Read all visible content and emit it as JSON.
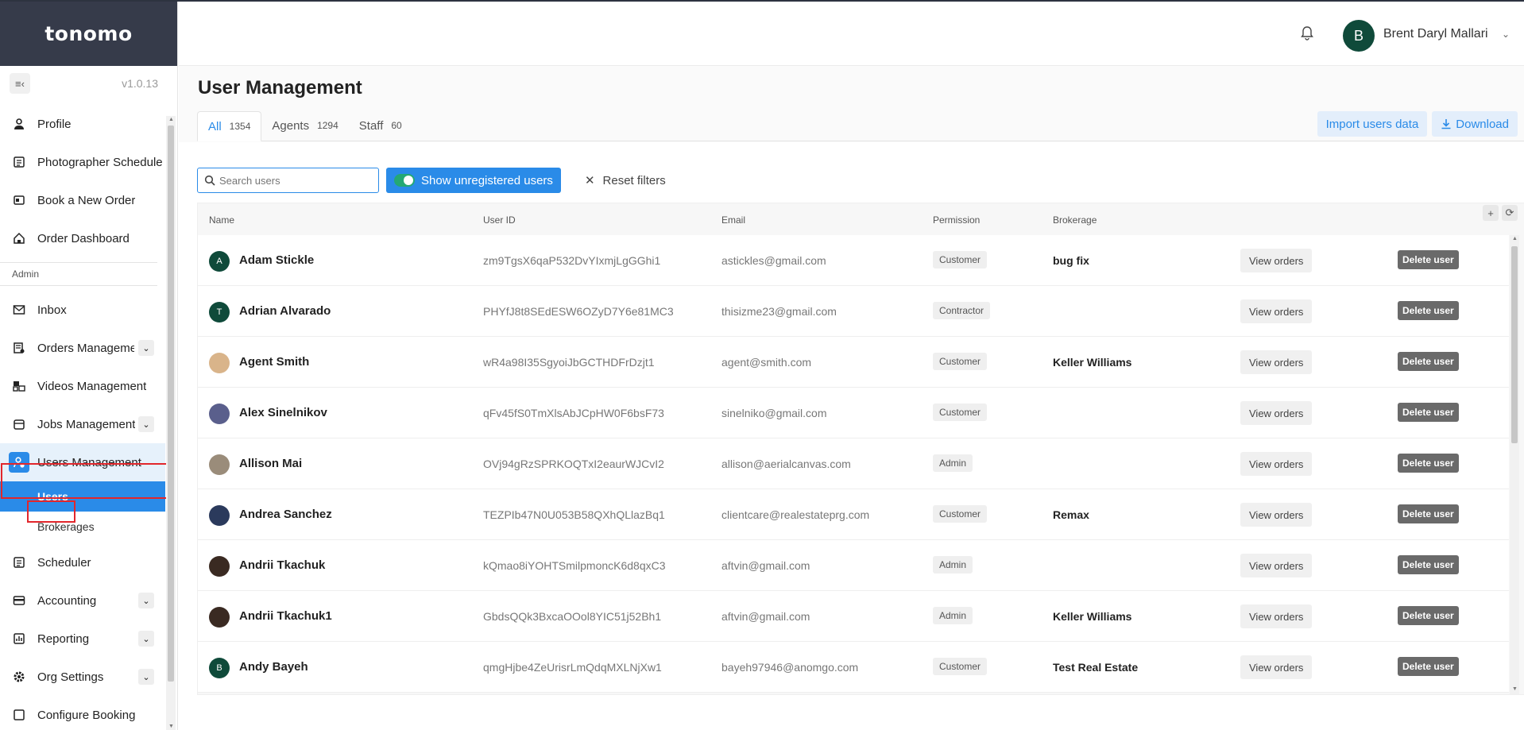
{
  "app": {
    "logo": "tonomo",
    "version": "v1.0.13"
  },
  "header": {
    "user_initial": "B",
    "user_name": "Brent Daryl Mallari"
  },
  "sidebar": {
    "items": [
      {
        "label": "Profile",
        "icon": "user-icon"
      },
      {
        "label": "Photographer Schedule",
        "icon": "schedule-icon"
      },
      {
        "label": "Book a New Order",
        "icon": "book-icon"
      },
      {
        "label": "Order Dashboard",
        "icon": "home-icon"
      }
    ],
    "section_label": "Admin",
    "admin_items": [
      {
        "label": "Inbox",
        "icon": "mail-icon"
      },
      {
        "label": "Orders Management",
        "icon": "orders-icon"
      },
      {
        "label": "Videos Management",
        "icon": "video-icon"
      },
      {
        "label": "Jobs Management",
        "icon": "jobs-icon"
      },
      {
        "label": "Users Management",
        "icon": "users-icon"
      }
    ],
    "sub_items": [
      {
        "label": "Users"
      },
      {
        "label": "Brokerages"
      }
    ],
    "bottom_items": [
      {
        "label": "Scheduler"
      },
      {
        "label": "Accounting"
      },
      {
        "label": "Reporting"
      },
      {
        "label": "Org Settings"
      },
      {
        "label": "Configure Booking"
      }
    ]
  },
  "page": {
    "title": "User Management",
    "tabs": [
      {
        "label": "All",
        "count": "1354"
      },
      {
        "label": "Agents",
        "count": "1294"
      },
      {
        "label": "Staff",
        "count": "60"
      }
    ],
    "import_label": "Import users data",
    "download_label": "Download"
  },
  "filters": {
    "search_placeholder": "Search users",
    "toggle_label": "Show unregistered users",
    "reset_label": "Reset filters"
  },
  "table": {
    "columns": {
      "name": "Name",
      "user_id": "User ID",
      "email": "Email",
      "permission": "Permission",
      "brokerage": "Brokerage"
    },
    "view_label": "View orders",
    "delete_label": "Delete user",
    "rows": [
      {
        "initial": "A",
        "avatar_color": "#0f4a3a",
        "name": "Adam Stickle",
        "user_id": "zm9TgsX6qaP532DvYIxmjLgGGhi1",
        "email": "astickles@gmail.com",
        "permission": "Customer",
        "brokerage": "bug fix"
      },
      {
        "initial": "T",
        "avatar_color": "#0f4a3a",
        "name": "Adrian Alvarado",
        "user_id": "PHYfJ8t8SEdESW6OZyD7Y6e81MC3",
        "email": "thisizme23@gmail.com",
        "permission": "Contractor",
        "brokerage": ""
      },
      {
        "initial": "",
        "avatar_color": "#d9b48a",
        "name": "Agent Smith",
        "user_id": "wR4a98I35SgyoiJbGCTHDFrDzjt1",
        "email": "agent@smith.com",
        "permission": "Customer",
        "brokerage": "Keller Williams"
      },
      {
        "initial": "",
        "avatar_color": "#5a5f8c",
        "name": "Alex Sinelnikov",
        "user_id": "qFv45fS0TmXlsAbJCpHW0F6bsF73",
        "email": "sinelniko@gmail.com",
        "permission": "Customer",
        "brokerage": ""
      },
      {
        "initial": "",
        "avatar_color": "#9a8c7a",
        "name": "Allison Mai",
        "user_id": "OVj94gRzSPRKOQTxI2eaurWJCvI2",
        "email": "allison@aerialcanvas.com",
        "permission": "Admin",
        "brokerage": ""
      },
      {
        "initial": "",
        "avatar_color": "#2b3a5c",
        "name": "Andrea Sanchez",
        "user_id": "TEZPIb47N0U053B58QXhQLlazBq1",
        "email": "clientcare@realestateprg.com",
        "permission": "Customer",
        "brokerage": "Remax"
      },
      {
        "initial": "",
        "avatar_color": "#3a2a22",
        "name": "Andrii Tkachuk",
        "user_id": "kQmao8iYOHTSmilpmoncK6d8qxC3",
        "email": "aftvin@gmail.com",
        "permission": "Admin",
        "brokerage": ""
      },
      {
        "initial": "",
        "avatar_color": "#3a2a22",
        "name": "Andrii Tkachuk1",
        "user_id": "GbdsQQk3BxcaOOol8YIC51j52Bh1",
        "email": "aftvin@gmail.com",
        "permission": "Admin",
        "brokerage": "Keller Williams"
      },
      {
        "initial": "B",
        "avatar_color": "#0f4a3a",
        "name": "Andy Bayeh",
        "user_id": "qmgHjbe4ZeUrisrLmQdqMXLNjXw1",
        "email": "bayeh97946@anomgo.com",
        "permission": "Customer",
        "brokerage": "Test Real Estate"
      }
    ]
  },
  "colors": {
    "accent": "#2a8be8",
    "highlight": "#e2262b",
    "logo_bg": "#363b4a"
  }
}
